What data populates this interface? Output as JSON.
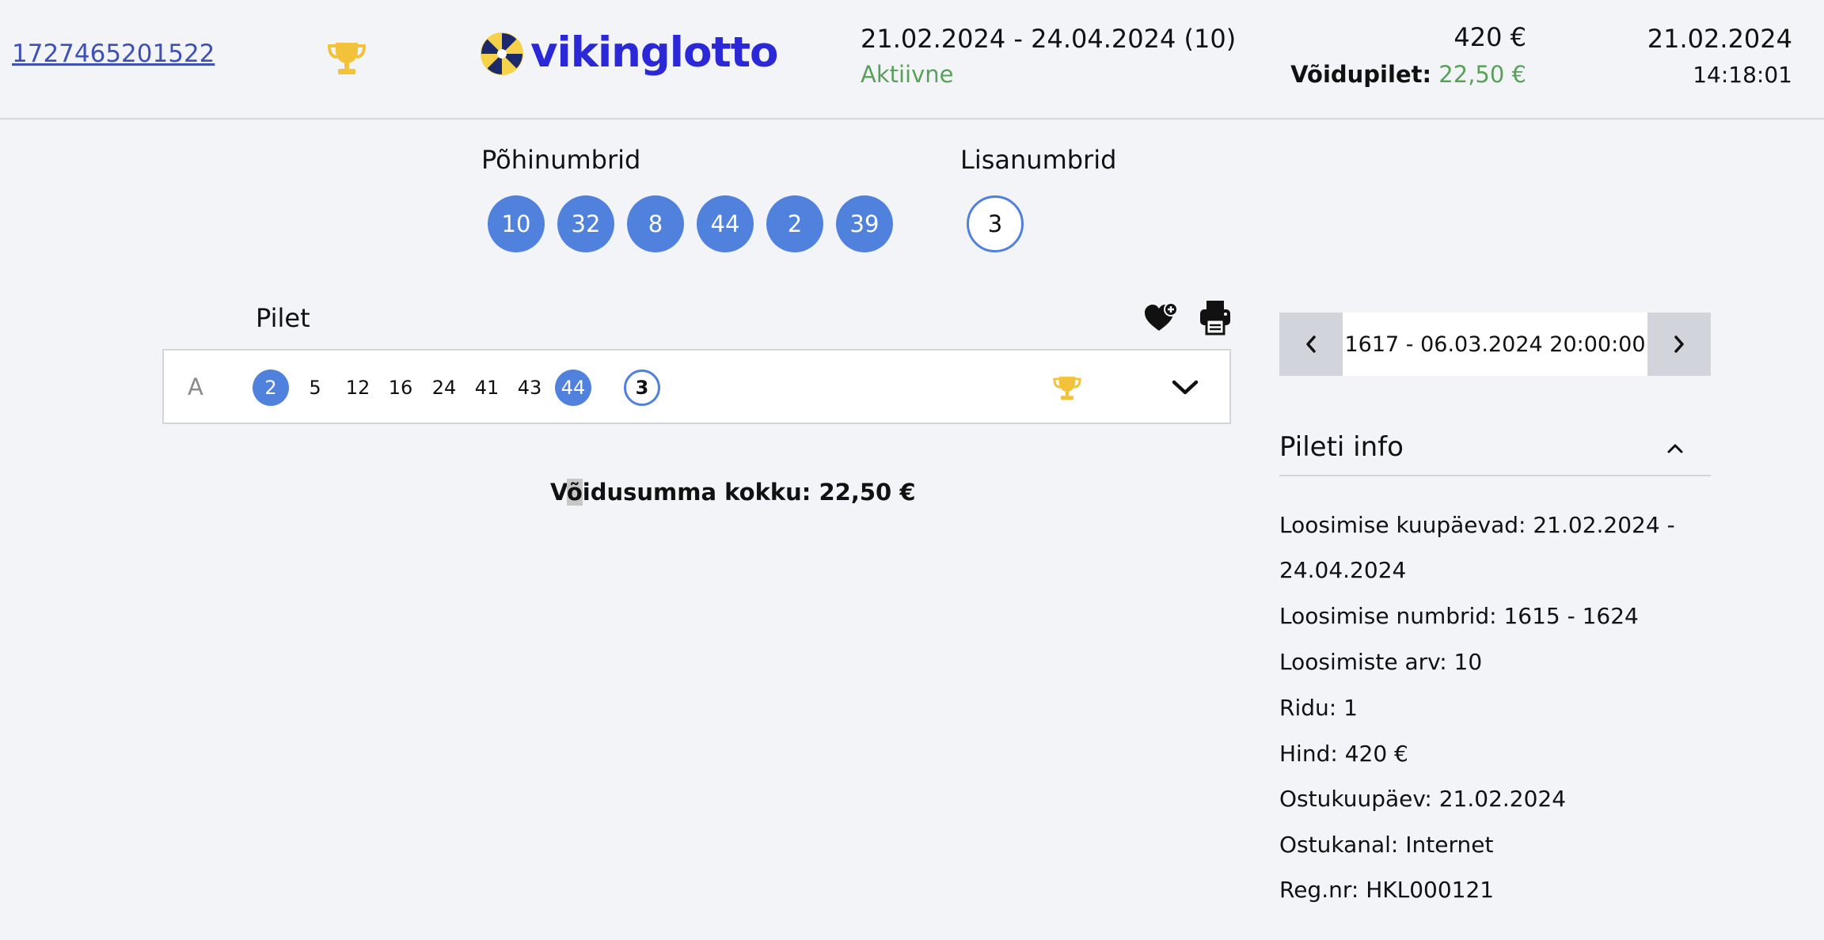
{
  "header": {
    "ticket_id": "1727465201522",
    "logo_text": "vikinglotto",
    "period": "21.02.2024 - 24.04.2024 (10)",
    "status": "Aktiivne",
    "price": "420 €",
    "win_ticket_label": "Võidupilet:",
    "win_ticket_value": "22,50 €",
    "date": "21.02.2024",
    "time": "14:18:01"
  },
  "drawn": {
    "main_title": "Põhinumbrid",
    "extra_title": "Lisanumbrid",
    "main_numbers": [
      "10",
      "32",
      "8",
      "44",
      "2",
      "39"
    ],
    "extra_numbers": [
      "3"
    ]
  },
  "ticket": {
    "title": "Pilet",
    "row_label": "A",
    "numbers": [
      "2",
      "5",
      "12",
      "16",
      "24",
      "41",
      "43",
      "44"
    ],
    "hits": [
      true,
      false,
      false,
      false,
      false,
      false,
      false,
      true
    ],
    "extra_number": "3",
    "total_prefix": "V",
    "total_highlight": "õ",
    "total_rest": "idusumma kokku: 22,50 €"
  },
  "draw_selector": {
    "value": "1617 - 06.03.2024 20:00:00"
  },
  "info": {
    "title": "Pileti info",
    "lines": [
      "Loosimise kuupäevad: 21.02.2024 -",
      "24.04.2024",
      "Loosimise numbrid: 1615 - 1624",
      "Loosimiste arv: 10",
      "Ridu: 1",
      "Hind: 420 €",
      "Ostukuupäev: 21.02.2024",
      "Ostukanal: Internet",
      "Reg.nr: HKL000121"
    ]
  },
  "colors": {
    "accent_blue": "#5081dc",
    "logo_blue": "#2b28d8",
    "status_green": "#5aa05a",
    "trophy_gold": "#f2c23a"
  },
  "icons": {
    "head_trophy": "trophy-icon",
    "row_trophy": "trophy-icon",
    "favorite": "heart-plus-icon",
    "print": "printer-icon",
    "prev": "chevron-left-icon",
    "next": "chevron-right-icon",
    "expand": "chevron-down-icon",
    "collapse": "chevron-up-icon"
  }
}
